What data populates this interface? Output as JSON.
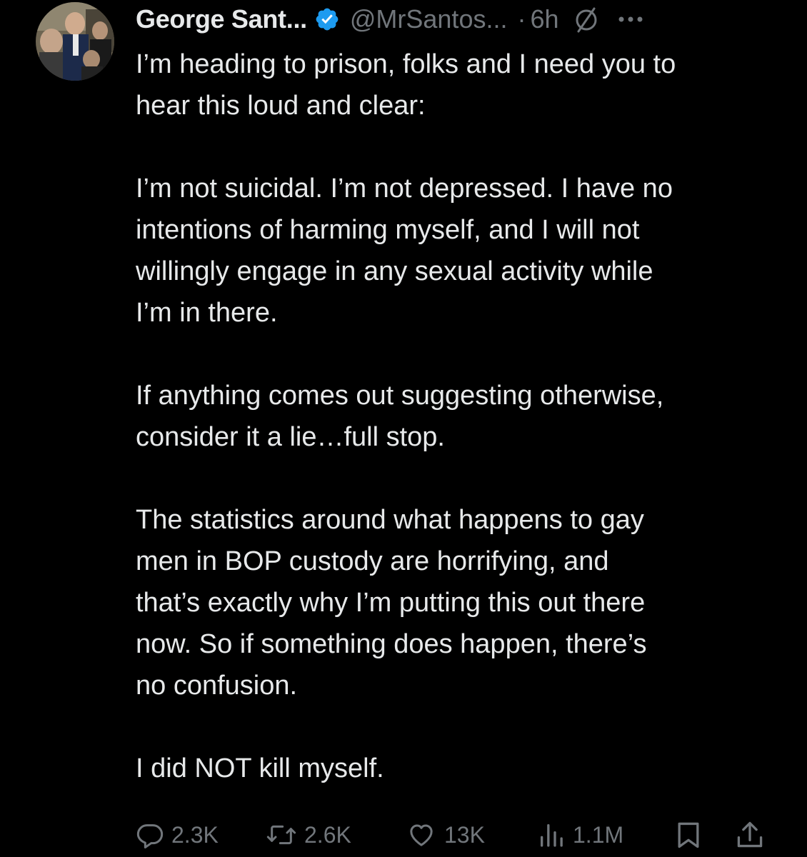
{
  "tweet": {
    "author": {
      "display_name": "George Sant...",
      "handle": "@MrSantos...",
      "verified": true,
      "avatar_alt": "profile photo"
    },
    "separator": "·",
    "time": "6h",
    "icons": {
      "verified": "verified-badge-icon",
      "hidden": "hidden-reply-icon",
      "more": "more-options-icon"
    },
    "colors": {
      "background": "#000000",
      "text": "#e7e9ea",
      "muted": "#71767b",
      "verified_blue": "#1d9bf0"
    },
    "paragraphs": [
      [
        "I’m heading to prison, folks and I need you to",
        "hear this loud and clear:"
      ],
      [
        "I’m not suicidal. I’m not depressed. I have no",
        "intentions of harming myself, and I will not",
        "willingly engage in any sexual activity while",
        "I’m in there."
      ],
      [
        "If anything comes out suggesting otherwise,",
        "consider it a lie…full stop."
      ],
      [
        "The statistics around what happens to gay",
        "men in BOP custody are horrifying, and",
        "that’s exactly why I’m putting this out there",
        "now. So if something does happen, there’s",
        "no confusion."
      ],
      [
        "I did NOT kill myself."
      ]
    ],
    "actions": {
      "replies": "2.3K",
      "reposts": "2.6K",
      "likes": "13K",
      "views": "1.1M"
    }
  }
}
